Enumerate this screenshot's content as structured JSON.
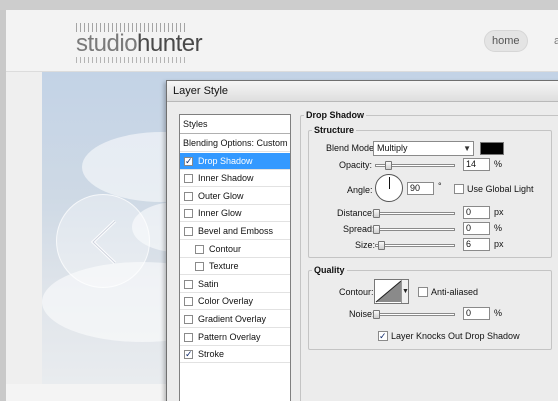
{
  "website": {
    "logo": {
      "part1": "studio",
      "part2": "hunter"
    },
    "nav": {
      "home": "home",
      "next": "a"
    }
  },
  "dialog": {
    "title": "Layer Style",
    "styles_panel": {
      "header": "Styles",
      "items": [
        {
          "label": "Blending Options: Custom",
          "checkbox": false,
          "checked": false,
          "selected": false,
          "indent": false
        },
        {
          "label": "Drop Shadow",
          "checkbox": true,
          "checked": true,
          "selected": true,
          "indent": false
        },
        {
          "label": "Inner Shadow",
          "checkbox": true,
          "checked": false,
          "selected": false,
          "indent": false
        },
        {
          "label": "Outer Glow",
          "checkbox": true,
          "checked": false,
          "selected": false,
          "indent": false
        },
        {
          "label": "Inner Glow",
          "checkbox": true,
          "checked": false,
          "selected": false,
          "indent": false
        },
        {
          "label": "Bevel and Emboss",
          "checkbox": true,
          "checked": false,
          "selected": false,
          "indent": false
        },
        {
          "label": "Contour",
          "checkbox": true,
          "checked": false,
          "selected": false,
          "indent": true
        },
        {
          "label": "Texture",
          "checkbox": true,
          "checked": false,
          "selected": false,
          "indent": true
        },
        {
          "label": "Satin",
          "checkbox": true,
          "checked": false,
          "selected": false,
          "indent": false
        },
        {
          "label": "Color Overlay",
          "checkbox": true,
          "checked": false,
          "selected": false,
          "indent": false
        },
        {
          "label": "Gradient Overlay",
          "checkbox": true,
          "checked": false,
          "selected": false,
          "indent": false
        },
        {
          "label": "Pattern Overlay",
          "checkbox": true,
          "checked": false,
          "selected": false,
          "indent": false
        },
        {
          "label": "Stroke",
          "checkbox": true,
          "checked": true,
          "selected": false,
          "indent": false
        }
      ]
    },
    "drop_shadow": {
      "section_title": "Drop Shadow",
      "structure": {
        "title": "Structure",
        "blend_mode_label": "Blend Mode:",
        "blend_mode_value": "Multiply",
        "shadow_color": "#000000",
        "opacity_label": "Opacity:",
        "opacity_value": "14",
        "opacity_unit": "%",
        "angle_label": "Angle:",
        "angle_value": "90",
        "angle_unit": "°",
        "use_global_light_label": "Use Global Light",
        "use_global_light_checked": false,
        "distance_label": "Distance:",
        "distance_value": "0",
        "distance_unit": "px",
        "spread_label": "Spread:",
        "spread_value": "0",
        "spread_unit": "%",
        "size_label": "Size:",
        "size_value": "6",
        "size_unit": "px"
      },
      "quality": {
        "title": "Quality",
        "contour_label": "Contour:",
        "anti_aliased_label": "Anti-aliased",
        "anti_aliased_checked": false,
        "noise_label": "Noise:",
        "noise_value": "0",
        "noise_unit": "%",
        "knocks_out_label": "Layer Knocks Out Drop Shadow",
        "knocks_out_checked": true
      }
    }
  },
  "colors": {
    "selection": "#3399ff",
    "dialog_bg": "#ececec"
  }
}
